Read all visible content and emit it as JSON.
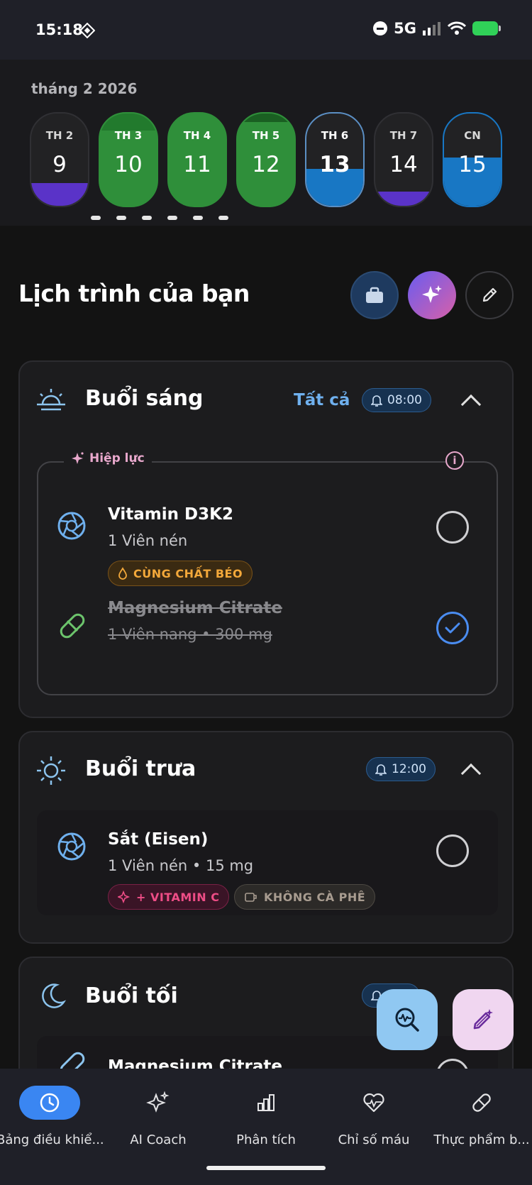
{
  "status_bar": {
    "time": "15:18",
    "network": "5G"
  },
  "calendar": {
    "month_label": "tháng 2 2026",
    "days": [
      {
        "name": "TH 2",
        "num": "9"
      },
      {
        "name": "TH 3",
        "num": "10"
      },
      {
        "name": "TH 4",
        "num": "11"
      },
      {
        "name": "TH 5",
        "num": "12"
      },
      {
        "name": "TH 6",
        "num": "13"
      },
      {
        "name": "TH 7",
        "num": "14"
      },
      {
        "name": "CN",
        "num": "15"
      }
    ],
    "selected_day": "13",
    "colors": {
      "green": "#2f8f3a",
      "blue": "#1877c4",
      "purple": "#5a33c8"
    }
  },
  "schedule": {
    "title": "Lịch trình của bạn"
  },
  "morning": {
    "title": "Buổi sáng",
    "all_link": "Tất cả",
    "reminder": "08:00",
    "synergy_label": "Hiệp lực",
    "items": [
      {
        "name": "Vitamin D3K2",
        "dose": "1 Viên nén",
        "tag": "CÙNG CHẤT BÉO",
        "done": false
      },
      {
        "name": "Magnesium Citrate",
        "dose": "1 Viên nang  •  300 mg",
        "done": true
      }
    ]
  },
  "noon": {
    "title": "Buổi trưa",
    "reminder": "12:00",
    "items": [
      {
        "name": "Sắt (Eisen)",
        "dose": "1 Viên nén  •  15 mg",
        "tags": [
          "+ VITAMIN C",
          "KHÔNG CÀ PHÊ"
        ],
        "done": false
      }
    ]
  },
  "night": {
    "title": "Buổi tối",
    "items": [
      {
        "name": "Magnesium Citrate"
      }
    ]
  },
  "nav": {
    "items": [
      {
        "label": "Bảng điều khiể...",
        "icon": "clock-icon",
        "active": true
      },
      {
        "label": "AI Coach",
        "icon": "sparkle-icon",
        "active": false
      },
      {
        "label": "Phân tích",
        "icon": "bar-chart-icon",
        "active": false
      },
      {
        "label": "Chỉ số máu",
        "icon": "heart-pulse-icon",
        "active": false
      },
      {
        "label": "Thực phẩm b...",
        "icon": "pill-icon",
        "active": false
      }
    ]
  }
}
